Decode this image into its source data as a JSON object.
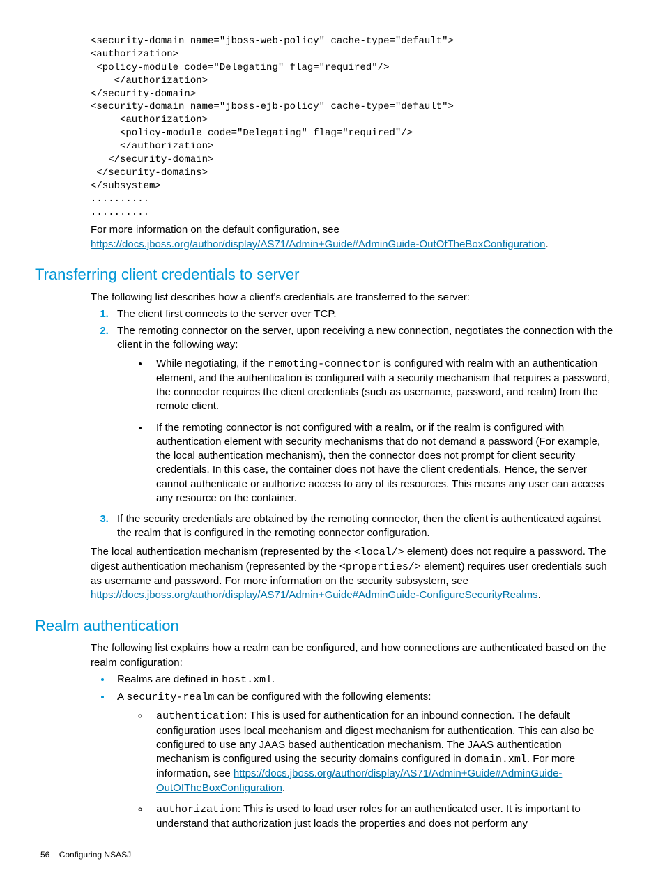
{
  "code_block": "<security-domain name=\"jboss-web-policy\" cache-type=\"default\">\n<authorization>\n <policy-module code=\"Delegating\" flag=\"required\"/>\n    </authorization>\n</security-domain>\n<security-domain name=\"jboss-ejb-policy\" cache-type=\"default\">\n     <authorization>\n     <policy-module code=\"Delegating\" flag=\"required\"/>\n     </authorization>\n   </security-domain>\n </security-domains>\n</subsystem>\n..........\n..........",
  "para1_a": "For more information on the default configuration, see ",
  "link1": "https://docs.jboss.org/author/display/AS71/Admin+Guide#AdminGuide-OutOfTheBoxConfiguration",
  "h1": "Transferring client credentials to server",
  "p2": "The following list describes how a client's credentials are transferred to the server:",
  "ol1": "The client first connects to the server over TCP.",
  "ol2": "The remoting connector on the server, upon receiving a new connection, negotiates the connection with the client in the following way:",
  "ol2_b1_a": "While negotiating, if the ",
  "ol2_b1_code": "remoting-connector",
  "ol2_b1_b": " is configured with realm with an authentication element, and the authentication is configured with a security mechanism that requires a password, the connector requires the client credentials (such as username, password, and realm) from the remote client.",
  "ol2_b2": "If the remoting connector is not configured with a realm, or if the realm is configured with authentication element with security mechanisms that do not demand a password (For example, the local authentication mechanism), then the connector does not prompt for client security credentials. In this case, the container does not have the client credentials. Hence, the server cannot authenticate or authorize access to any of its resources. This means any user can access any resource on the container.",
  "ol3": "If the security credentials are obtained by the remoting connector, then the client is authenticated against the realm that is configured in the remoting connector configuration.",
  "p3_a": "The local authentication mechanism (represented by the ",
  "p3_code1": " <local/>",
  "p3_b": " element) does not require a password. The digest authentication mechanism (represented by the ",
  "p3_code2": "<properties/>",
  "p3_c": " element) requires user credentials such as username and password. For more information on the security subsystem, see ",
  "link2": "https://docs.jboss.org/author/display/AS71/Admin+Guide#AdminGuide-ConfigureSecurityRealms",
  "h2": "Realm authentication",
  "p4": "The following list explains how a realm can be configured, and how connections are authenticated based on the realm configuration:",
  "ra_b1_a": "Realms are defined in ",
  "ra_b1_code": "host.xml",
  "ra_b2_a": "A ",
  "ra_b2_code": "security-realm",
  "ra_b2_b": " can be configured with the following elements:",
  "ra_s1_code": "authentication",
  "ra_s1_a": ": This is used for authentication for an inbound connection. The default configuration uses local mechanism and digest mechanism for authentication. This can also be configured to use any JAAS based authentication mechanism. The JAAS authentication mechanism is configured using the security domains configured in ",
  "ra_s1_code2": "domain.xml",
  "ra_s1_b": ". For more information, see ",
  "link3": "https://docs.jboss.org/author/display/AS71/Admin+Guide#AdminGuide-OutOfTheBoxConfiguration",
  "ra_s2_code": "authorization",
  "ra_s2_a": ": This is used to load user roles for an authenticated user. It is important to understand that authorization just loads the properties and does not perform any",
  "footer_page": "56",
  "footer_title": "Configuring NSASJ"
}
